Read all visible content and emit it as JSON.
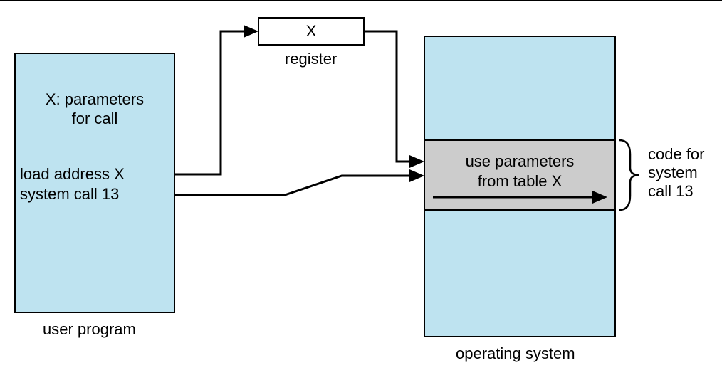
{
  "user_program": {
    "title_line1": "X: parameters",
    "title_line2": "for call",
    "line3": "load address X",
    "line4": "system call 13",
    "caption": "user program"
  },
  "register": {
    "value": "X",
    "label": "register"
  },
  "os": {
    "line1": "use parameters",
    "line2": "from table X",
    "caption": "operating system"
  },
  "brace": {
    "line1": "code for",
    "line2": "system",
    "line3": "call 13"
  }
}
